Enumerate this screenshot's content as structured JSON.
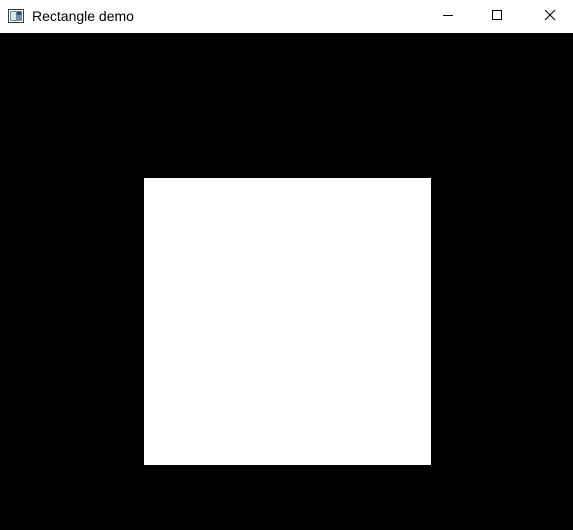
{
  "window": {
    "title": "Rectangle demo",
    "app_icon": "app-window-icon",
    "controls": {
      "minimize_icon": "minimize-icon",
      "maximize_icon": "maximize-icon",
      "close_icon": "close-icon"
    }
  },
  "canvas": {
    "background_color": "#000000",
    "rectangle_color": "#ffffff"
  }
}
